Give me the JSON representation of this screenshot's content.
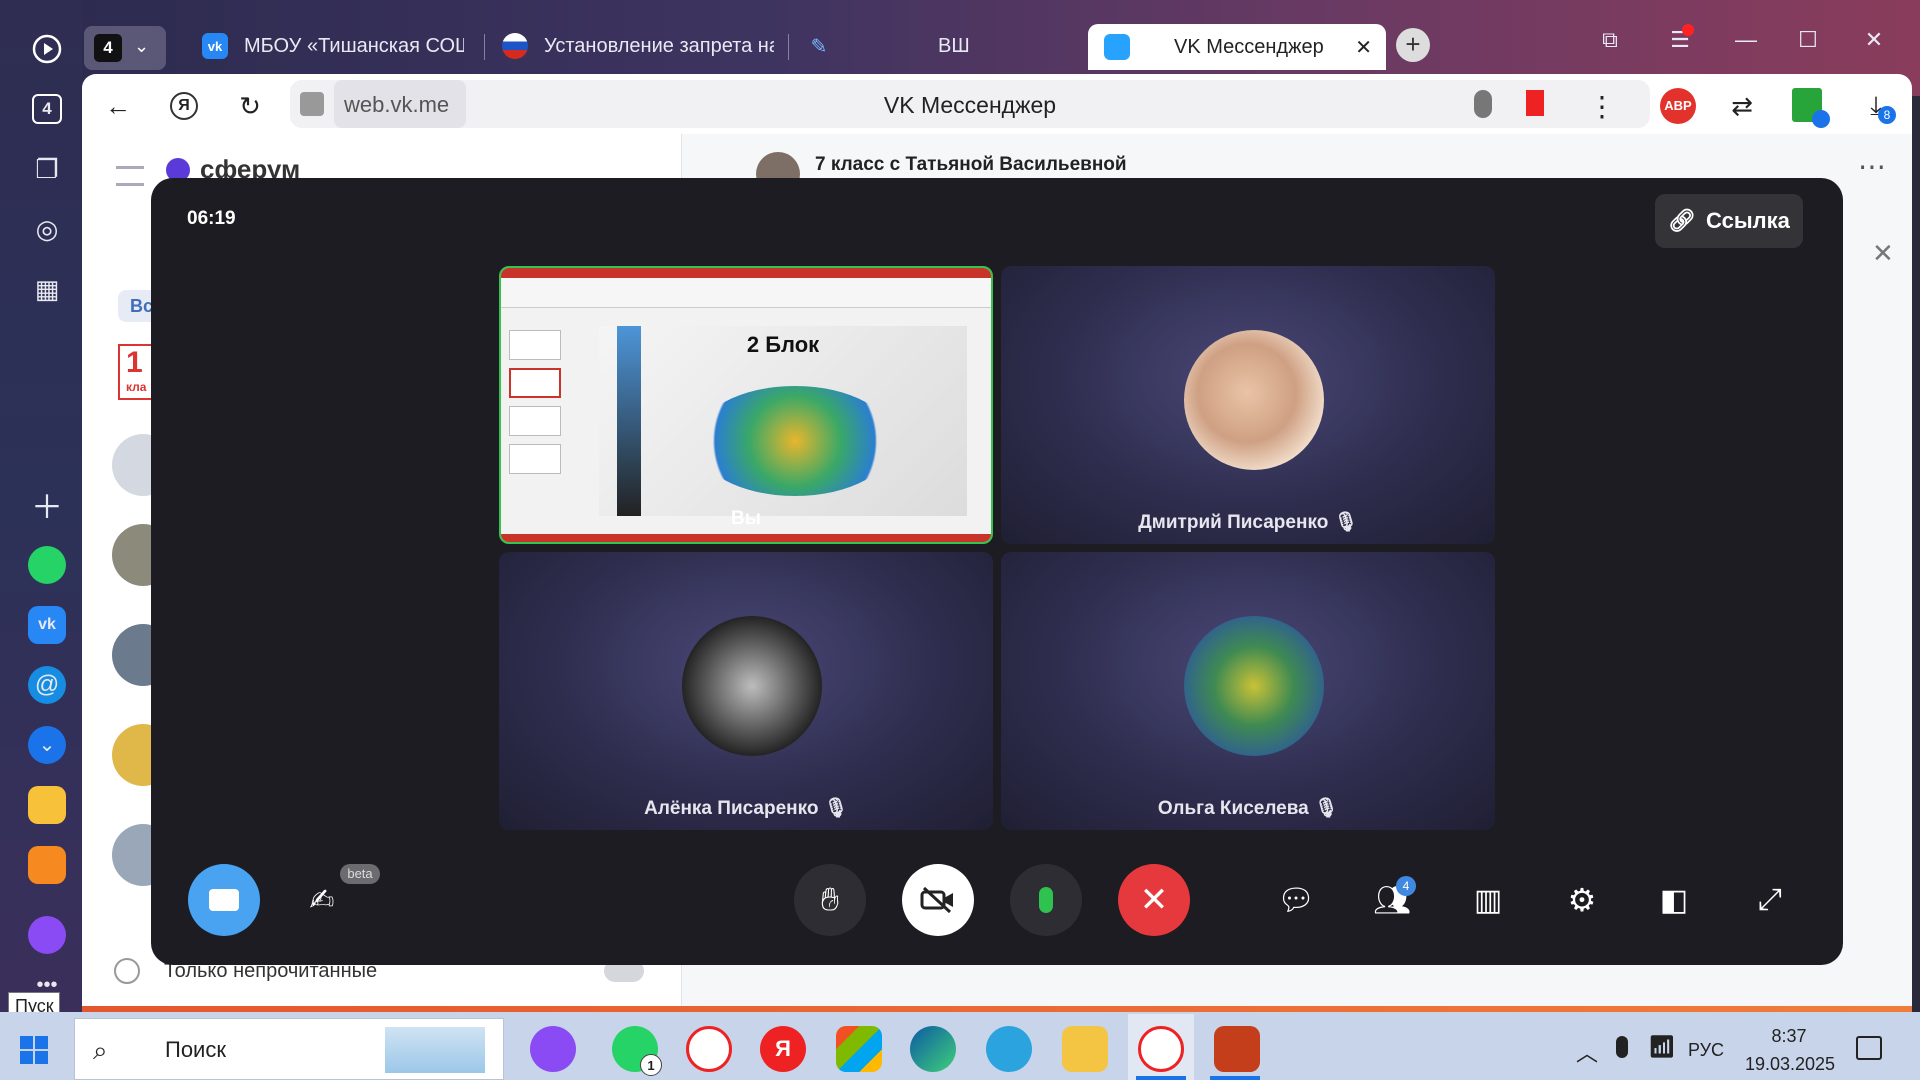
{
  "browser": {
    "tab_count": "4",
    "tabs": [
      {
        "label": "МБОУ «Тишанская СОШ»"
      },
      {
        "label": "Установление запрета на"
      },
      {
        "label": "ВШ"
      },
      {
        "label": "VK Мессенджер"
      }
    ],
    "address": "web.vk.me",
    "page_title": "VK Мессенджер",
    "download_badge": "8",
    "adblock_label": "ABP",
    "yandex_label": "Я"
  },
  "background_app": {
    "brand": "сферум",
    "chat_title": "7 класс с Татьяной Васильевной",
    "filter_chip": "Все",
    "calendar_num": "1",
    "calendar_text": "кла",
    "unread_filter": "Только непрочитанные"
  },
  "call": {
    "timer": "06:19",
    "link_button": "Ссылка",
    "participants": [
      {
        "name": "Вы",
        "muted": false
      },
      {
        "name": "Дмитрий Писаренко",
        "muted": true
      },
      {
        "name": "Алёнка Писаренко",
        "muted": true
      },
      {
        "name": "Ольга Киселева",
        "muted": true
      }
    ],
    "slide_title": "2 Блок",
    "beta_badge": "beta",
    "participants_count": "4",
    "colors": {
      "end_call": "#e5393d",
      "accent": "#3f8ae0",
      "mic_on": "#2fc24f"
    }
  },
  "tooltip": "Пуск",
  "taskbar": {
    "search_label": "Поиск",
    "whatsapp_badge": "1",
    "yandex_label": "Я",
    "lang": "РУС",
    "time": "8:37",
    "date": "19.03.2025"
  }
}
